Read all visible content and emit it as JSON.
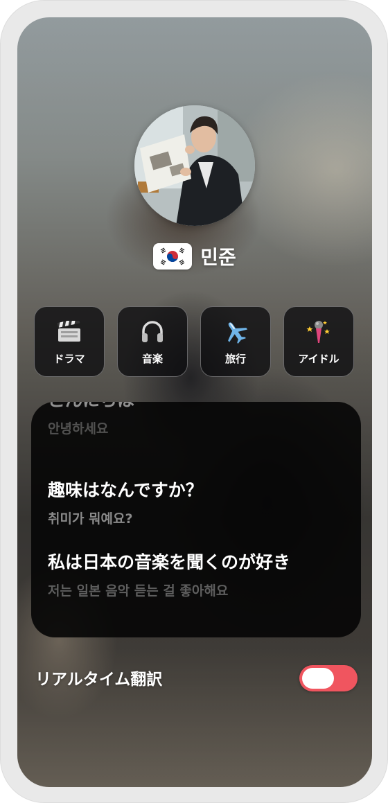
{
  "profile": {
    "name": "민준",
    "flag": "korea-flag-icon"
  },
  "categories": [
    {
      "label": "ドラマ",
      "icon": "clapperboard-icon"
    },
    {
      "label": "音楽",
      "icon": "headphones-icon"
    },
    {
      "label": "旅行",
      "icon": "airplane-icon"
    },
    {
      "label": "アイドル",
      "icon": "microphone-icon"
    }
  ],
  "phrases": [
    {
      "jp": "こんにちは",
      "ko": "안녕하세요"
    },
    {
      "jp": "趣味はなんですか？",
      "ko": "취미가 뭐예요?"
    },
    {
      "jp": "私は日本の音楽を聞くのが好き",
      "ko": "저는 일본 음악 듣는 걸 좋아해요"
    }
  ],
  "realtime": {
    "label": "リアルタイム翻訳",
    "enabled": true
  },
  "colors": {
    "toggle_on": "#f0555f"
  }
}
